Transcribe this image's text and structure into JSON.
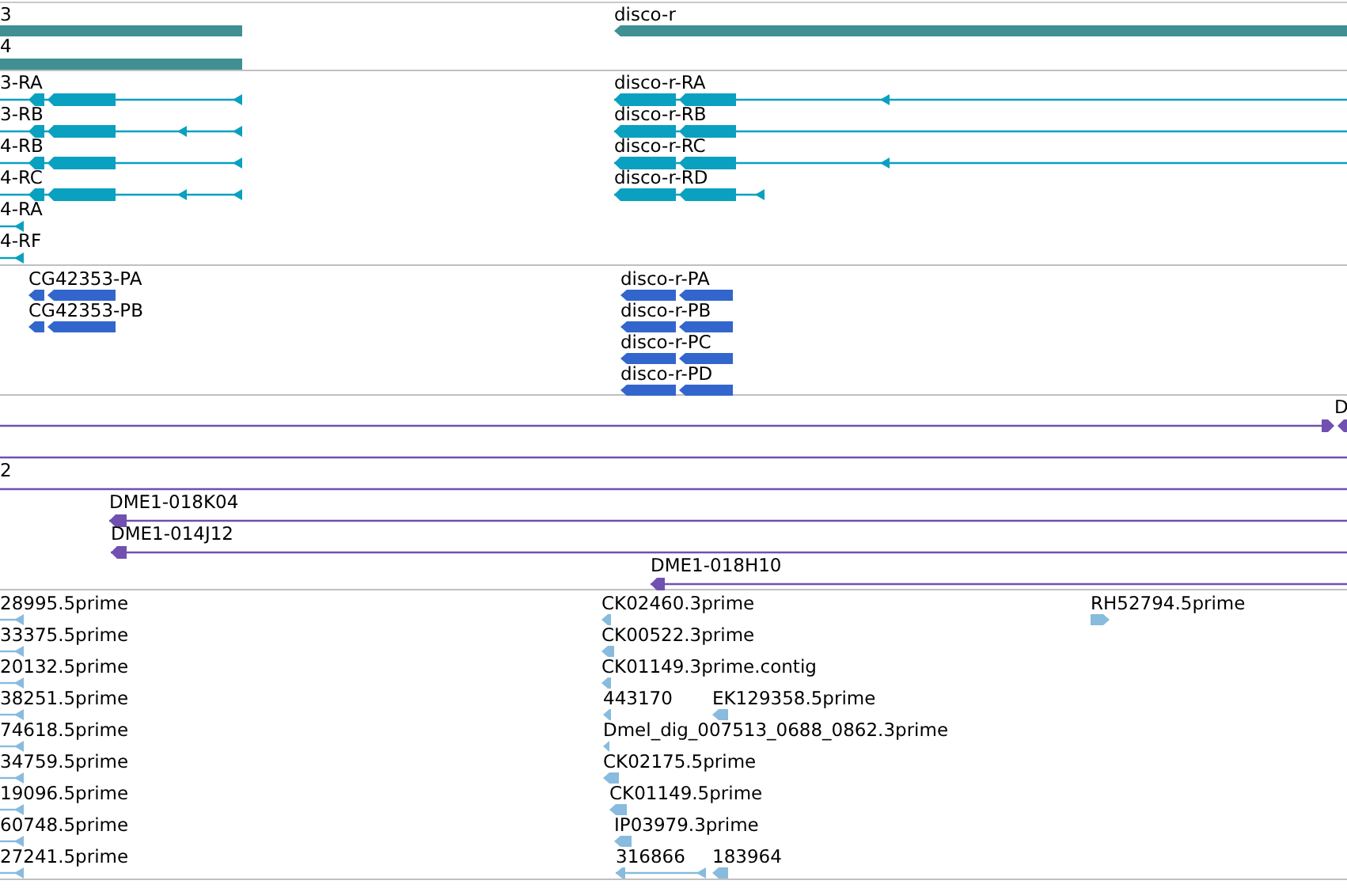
{
  "tracks": [
    {
      "kind": "gene",
      "features": [
        {
          "label": "3"
        },
        {
          "label": "4"
        },
        {
          "label": "disco-r"
        }
      ]
    },
    {
      "kind": "transcript",
      "features": [
        {
          "label": "3-RA"
        },
        {
          "label": "3-RB"
        },
        {
          "label": "4-RB"
        },
        {
          "label": "4-RC"
        },
        {
          "label": "4-RA"
        },
        {
          "label": "4-RF"
        },
        {
          "label": "disco-r-RA"
        },
        {
          "label": "disco-r-RB"
        },
        {
          "label": "disco-r-RC"
        },
        {
          "label": "disco-r-RD"
        }
      ]
    },
    {
      "kind": "protein",
      "features": [
        {
          "label": "CG42353-PA"
        },
        {
          "label": "CG42353-PB"
        },
        {
          "label": "disco-r-PA"
        },
        {
          "label": "disco-r-PB"
        },
        {
          "label": "disco-r-PC"
        },
        {
          "label": "disco-r-PD"
        }
      ]
    },
    {
      "kind": "clone",
      "features": [
        {
          "label": "D"
        },
        {
          "label": "2"
        },
        {
          "label": "DME1-018K04"
        },
        {
          "label": "DME1-014J12"
        },
        {
          "label": "DME1-018H10"
        }
      ]
    },
    {
      "kind": "est",
      "features": [
        {
          "label": "28995.5prime"
        },
        {
          "label": "33375.5prime"
        },
        {
          "label": "20132.5prime"
        },
        {
          "label": "38251.5prime"
        },
        {
          "label": "74618.5prime"
        },
        {
          "label": "34759.5prime"
        },
        {
          "label": "19096.5prime"
        },
        {
          "label": "60748.5prime"
        },
        {
          "label": "27241.5prime"
        },
        {
          "label": "CK02460.3prime"
        },
        {
          "label": "CK00522.3prime"
        },
        {
          "label": "CK01149.3prime.contig"
        },
        {
          "label": "443170"
        },
        {
          "label": "EK129358.5prime"
        },
        {
          "label": "Dmel_dig_007513_0688_0862.3prime"
        },
        {
          "label": "CK02175.5prime"
        },
        {
          "label": "CK01149.5prime"
        },
        {
          "label": "IP03979.3prime"
        },
        {
          "label": "316866"
        },
        {
          "label": "183964"
        },
        {
          "label": "RH52794.5prime"
        }
      ]
    }
  ]
}
